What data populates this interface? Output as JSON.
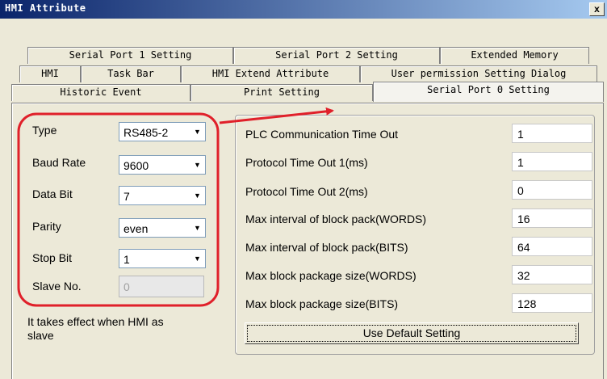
{
  "window": {
    "title": "HMI Attribute",
    "close_label": "x"
  },
  "tabs": {
    "row1": [
      "Serial Port 1 Setting",
      "Serial Port 2 Setting",
      "Extended Memory"
    ],
    "row2": [
      "HMI",
      "Task Bar",
      "HMI Extend Attribute",
      "User permission Setting Dialog"
    ],
    "row3": [
      "Historic Event",
      "Print Setting",
      "Serial Port 0 Setting"
    ]
  },
  "left": {
    "fields": [
      {
        "label": "Type",
        "value": "RS485-2"
      },
      {
        "label": "Baud Rate",
        "value": "9600"
      },
      {
        "label": "Data Bit",
        "value": "7"
      },
      {
        "label": "Parity",
        "value": "even"
      },
      {
        "label": "Stop Bit",
        "value": "1"
      }
    ],
    "slave": {
      "label": "Slave No.",
      "value": "0"
    },
    "note": "It takes effect when HMI as slave"
  },
  "right": {
    "fields": [
      {
        "label": "PLC Communication Time Out",
        "value": "1"
      },
      {
        "label": "Protocol Time Out 1(ms)",
        "value": "1"
      },
      {
        "label": "Protocol Time Out 2(ms)",
        "value": "0"
      },
      {
        "label": "Max interval of block pack(WORDS)",
        "value": "16"
      },
      {
        "label": "Max interval of block pack(BITS)",
        "value": "64"
      },
      {
        "label": "Max block package size(WORDS)",
        "value": "32"
      },
      {
        "label": "Max block package size(BITS)",
        "value": "128"
      }
    ],
    "default_button": "Use Default Setting"
  },
  "colors": {
    "annotation": "#e0202a",
    "titlebar_start": "#0a246a",
    "titlebar_end": "#a6caf0"
  }
}
